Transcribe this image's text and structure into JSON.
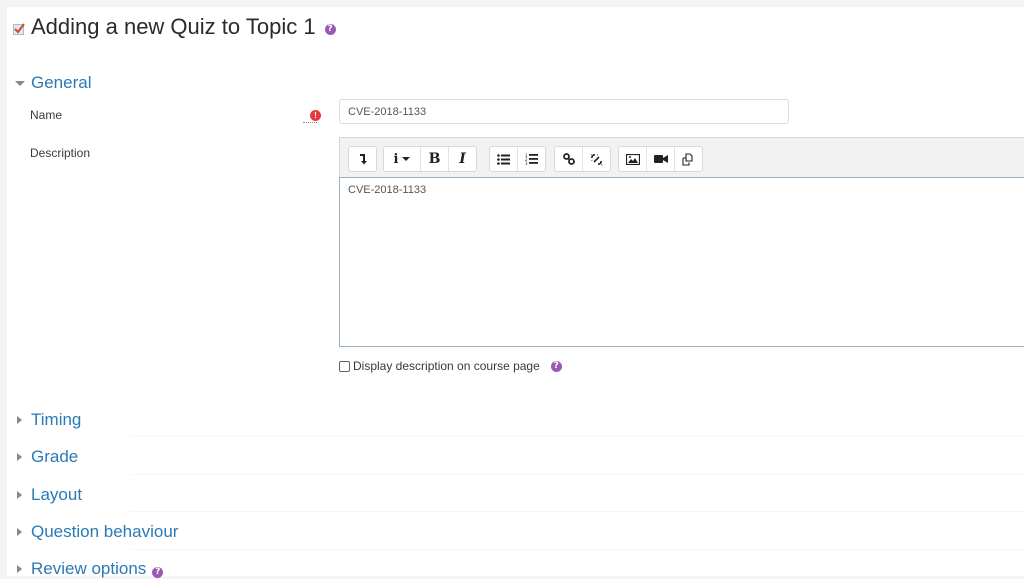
{
  "page": {
    "title": "Adding a new Quiz to Topic 1",
    "title_icon": "quiz-icon",
    "help_icon": "question-circle-icon"
  },
  "sections": {
    "general": {
      "label": "General",
      "expanded": true
    },
    "collapsed": [
      {
        "label": "Timing",
        "expanded": false
      },
      {
        "label": "Grade",
        "expanded": false
      },
      {
        "label": "Layout",
        "expanded": false
      },
      {
        "label": "Question behaviour",
        "expanded": false
      },
      {
        "label": "Review options",
        "expanded": false,
        "has_help": true
      }
    ]
  },
  "form": {
    "name": {
      "label": "Name",
      "value": "CVE-2018-1133",
      "required_icon": "exclamation-circle-icon"
    },
    "description": {
      "label": "Description",
      "content": "CVE-2018-1133",
      "toolbar": [
        [
          {
            "name": "toolbar-toggle",
            "icon": "level-down-icon"
          }
        ],
        [
          {
            "name": "paragraph-styles",
            "icon": "info-dropdown-icon"
          },
          {
            "name": "bold",
            "icon": "bold-icon",
            "glyph": "B"
          },
          {
            "name": "italic",
            "icon": "italic-icon",
            "glyph": "I"
          }
        ],
        [
          {
            "name": "unordered-list",
            "icon": "list-ul-icon"
          },
          {
            "name": "ordered-list",
            "icon": "list-ol-icon"
          }
        ],
        [
          {
            "name": "link",
            "icon": "link-icon"
          },
          {
            "name": "unlink",
            "icon": "unlink-icon"
          }
        ],
        [
          {
            "name": "insert-image",
            "icon": "image-icon"
          },
          {
            "name": "insert-media",
            "icon": "video-icon"
          },
          {
            "name": "manage-files",
            "icon": "files-icon"
          }
        ]
      ]
    },
    "show_description": {
      "label": "Display description on course page",
      "checked": false
    }
  },
  "colors": {
    "link_blue": "#2a7ab5",
    "help_purple": "#9b59b6",
    "required_red": "#e63b3b",
    "page_bg": "#f4f4f4"
  }
}
